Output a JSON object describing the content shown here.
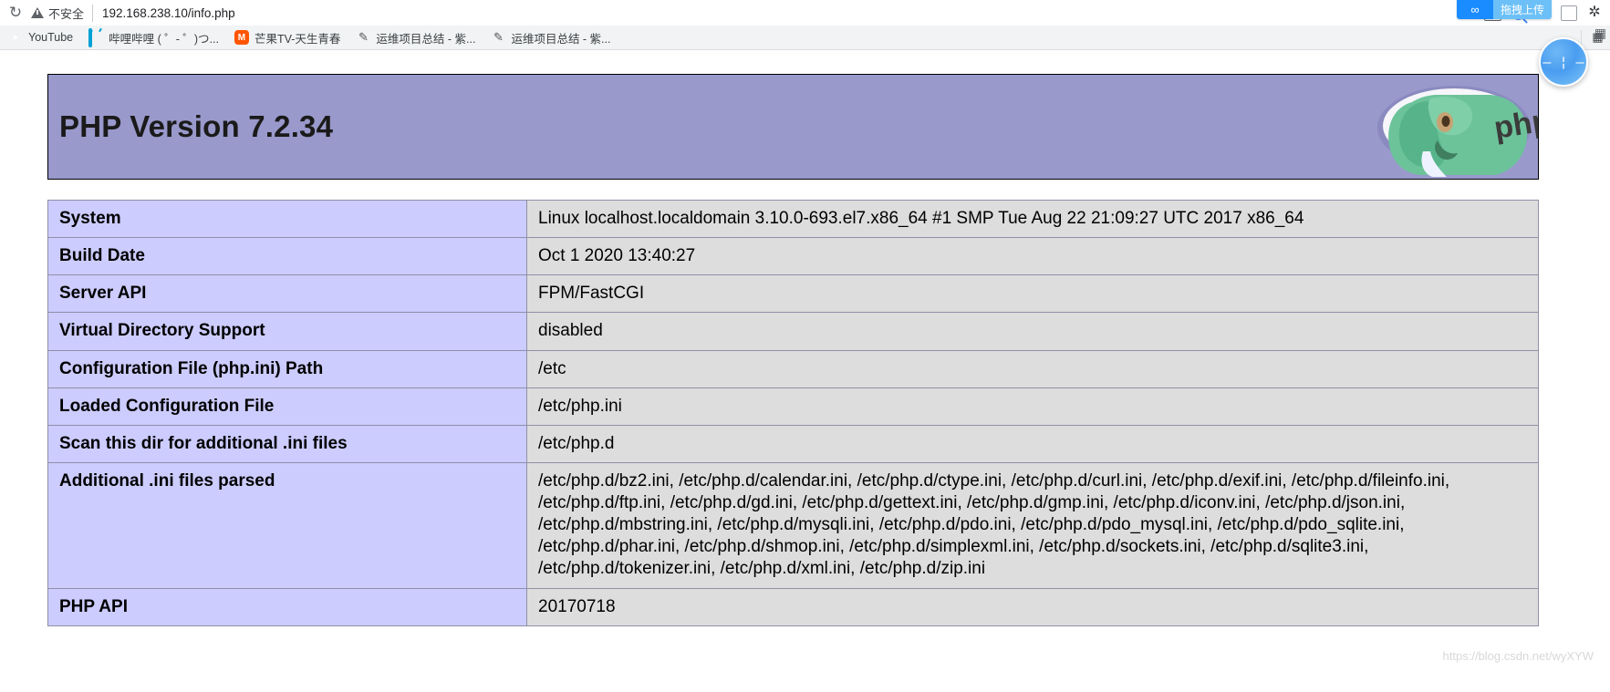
{
  "browser": {
    "reload_icon": "reload-icon",
    "security_label": "不安全",
    "url": "192.168.238.10/info.php",
    "toolbar_icons": [
      {
        "name": "translate-icon",
        "glyph": "文A"
      },
      {
        "name": "search-icon",
        "glyph": ""
      },
      {
        "name": "bookmark-star-icon",
        "glyph": "☆"
      },
      {
        "name": "profile-icon",
        "glyph": ""
      },
      {
        "name": "extensions-puzzle-icon",
        "glyph": "✦"
      }
    ],
    "upload_pill": {
      "icon": "infinity-icon",
      "icon_glyph": "∞",
      "label": "拖拽上传"
    },
    "bookmarks": [
      {
        "label": "YouTube",
        "icon": "youtube-favicon"
      },
      {
        "label": "哔哩哔哩 ( ゜- ゜)つ...",
        "icon": "bilibili-favicon"
      },
      {
        "label": "芒果TV-天生青春",
        "icon": "mangotv-favicon"
      },
      {
        "label": "运维项目总结 - 紫...",
        "icon": "csdn-favicon"
      },
      {
        "label": "运维项目总结 - 紫...",
        "icon": "csdn-favicon"
      }
    ]
  },
  "phpinfo": {
    "version_title": "PHP Version 7.2.34",
    "logo_alt": "php-elephant-logo",
    "rows": [
      {
        "key": "System",
        "value": "Linux localhost.localdomain 3.10.0-693.el7.x86_64 #1 SMP Tue Aug 22 21:09:27 UTC 2017 x86_64"
      },
      {
        "key": "Build Date",
        "value": "Oct 1 2020 13:40:27"
      },
      {
        "key": "Server API",
        "value": "FPM/FastCGI"
      },
      {
        "key": "Virtual Directory Support",
        "value": "disabled"
      },
      {
        "key": "Configuration File (php.ini) Path",
        "value": "/etc"
      },
      {
        "key": "Loaded Configuration File",
        "value": "/etc/php.ini"
      },
      {
        "key": "Scan this dir for additional .ini files",
        "value": "/etc/php.d"
      },
      {
        "key": "Additional .ini files parsed",
        "value": "/etc/php.d/bz2.ini, /etc/php.d/calendar.ini, /etc/php.d/ctype.ini, /etc/php.d/curl.ini, /etc/php.d/exif.ini, /etc/php.d/fileinfo.ini, /etc/php.d/ftp.ini, /etc/php.d/gd.ini, /etc/php.d/gettext.ini, /etc/php.d/gmp.ini, /etc/php.d/iconv.ini, /etc/php.d/json.ini, /etc/php.d/mbstring.ini, /etc/php.d/mysqli.ini, /etc/php.d/pdo.ini, /etc/php.d/pdo_mysql.ini, /etc/php.d/pdo_sqlite.ini, /etc/php.d/phar.ini, /etc/php.d/shmop.ini, /etc/php.d/simplexml.ini, /etc/php.d/sockets.ini, /etc/php.d/sqlite3.ini, /etc/php.d/tokenizer.ini, /etc/php.d/xml.ini, /etc/php.d/zip.ini"
      },
      {
        "key": "PHP API",
        "value": "20170718"
      }
    ]
  },
  "overlay": {
    "float_button_name": "floating-action-button",
    "float_button_glyph": "— ¦ —",
    "watermark": "https://blog.csdn.net/wyXYW"
  }
}
